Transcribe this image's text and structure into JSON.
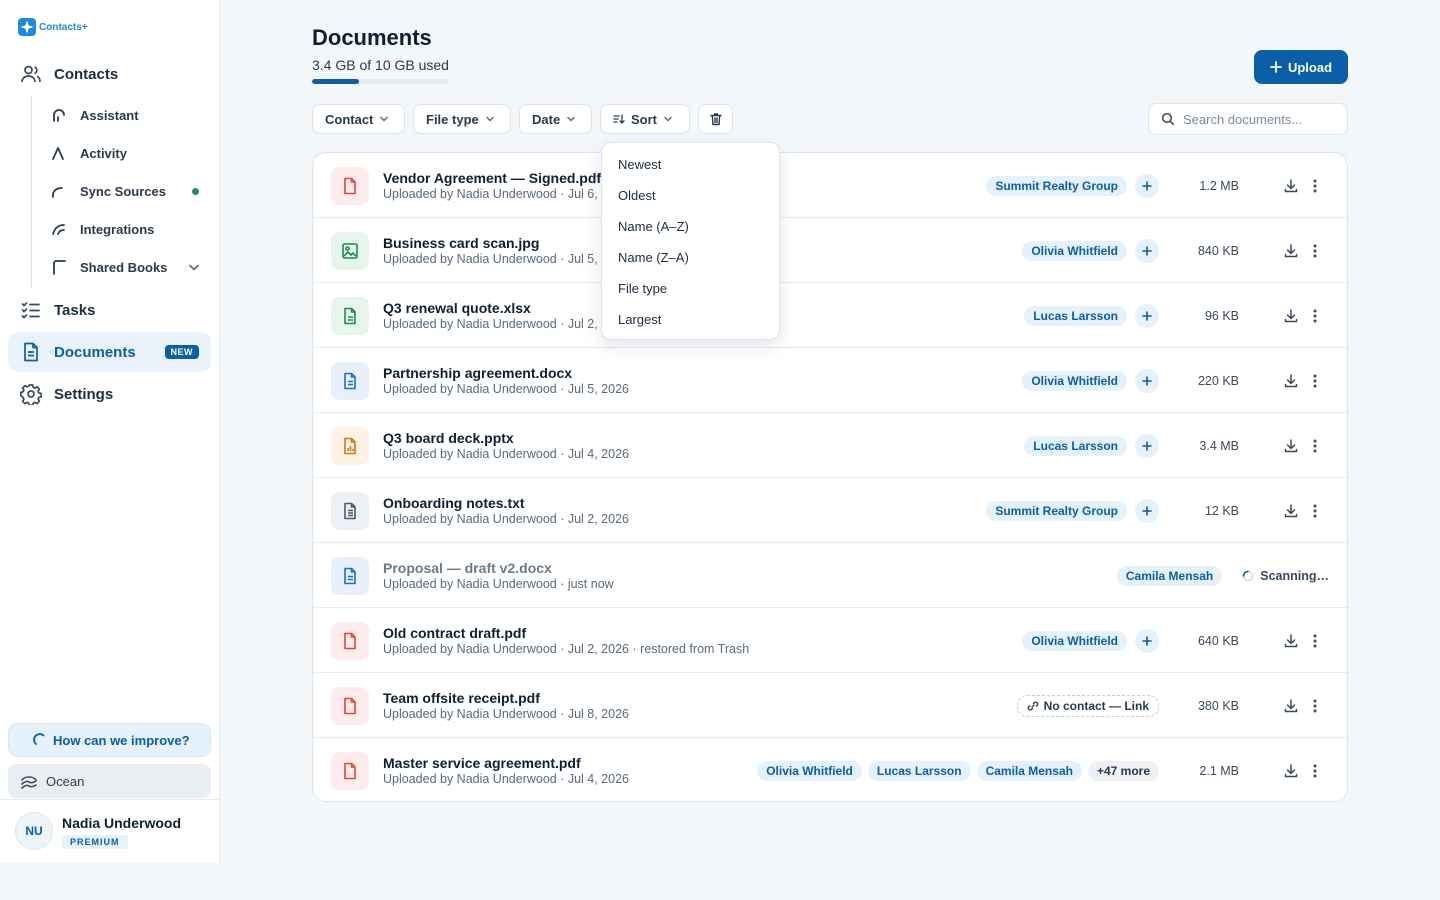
{
  "app": {
    "logo_text": "Contacts+"
  },
  "sidebar": {
    "main": [
      {
        "label": "Contacts",
        "icon": "users-icon"
      },
      {
        "label": "Tasks",
        "icon": "tasks-icon"
      },
      {
        "label": "Documents",
        "icon": "document-icon",
        "badge": "NEW",
        "active": true
      },
      {
        "label": "Settings",
        "icon": "gear-icon"
      }
    ],
    "sub": [
      {
        "label": "Assistant",
        "icon": "assistant-icon"
      },
      {
        "label": "Activity",
        "icon": "activity-icon"
      },
      {
        "label": "Sync Sources",
        "icon": "sync-icon",
        "status": "active"
      },
      {
        "label": "Integrations",
        "icon": "integrations-icon"
      },
      {
        "label": "Shared Books",
        "icon": "shared-books-icon"
      }
    ],
    "improve_label": "How can we improve?",
    "theme_label": "Ocean",
    "user": {
      "initials": "NU",
      "name": "Nadia Underwood",
      "plan": "PREMIUM"
    }
  },
  "header": {
    "title": "Documents",
    "storage_text": "3.4 GB of 10 GB used",
    "storage_used_fraction": 0.34,
    "upload_label": "Upload"
  },
  "filters": {
    "contact": "Contact",
    "file_type": "File type",
    "date": "Date",
    "sort": "Sort",
    "search_placeholder": "Search documents..."
  },
  "sort_menu": [
    "Newest",
    "Oldest",
    "Name (A–Z)",
    "Name (Z–A)",
    "File type",
    "Largest"
  ],
  "documents": [
    {
      "name": "Vendor Agreement — Signed.pdf",
      "meta": "Uploaded by Nadia Underwood · Jul 6, 2026",
      "type": "pdf",
      "tags": [
        "Summit Realty Group"
      ],
      "size": "1.2 MB"
    },
    {
      "name": "Business card scan.jpg",
      "meta": "Uploaded by Nadia Underwood · Jul 5, 2026",
      "type": "img",
      "tags": [
        "Olivia Whitfield"
      ],
      "size": "840 KB"
    },
    {
      "name": "Q3 renewal quote.xlsx",
      "meta": "Uploaded by Nadia Underwood · Jul 2, 2026",
      "type": "xls",
      "tags": [
        "Lucas Larsson"
      ],
      "size": "96 KB"
    },
    {
      "name": "Partnership agreement.docx",
      "meta": "Uploaded by Nadia Underwood · Jul 5, 2026",
      "type": "doc",
      "tags": [
        "Olivia Whitfield"
      ],
      "size": "220 KB"
    },
    {
      "name": "Q3 board deck.pptx",
      "meta": "Uploaded by Nadia Underwood · Jul 4, 2026",
      "type": "ppt",
      "tags": [
        "Lucas Larsson"
      ],
      "size": "3.4 MB"
    },
    {
      "name": "Onboarding notes.txt",
      "meta": "Uploaded by Nadia Underwood · Jul 2, 2026",
      "type": "txt",
      "tags": [
        "Summit Realty Group"
      ],
      "size": "12 KB"
    },
    {
      "name": "Proposal — draft v2.docx",
      "meta": "Uploaded by Nadia Underwood · just now",
      "type": "doc",
      "tags": [
        "Camila Mensah"
      ],
      "status": "Scanning…",
      "muted": true
    },
    {
      "name": "Old contract draft.pdf",
      "meta": "Uploaded by Nadia Underwood · Jul 2, 2026 · restored from Trash",
      "type": "pdf",
      "tags": [
        "Olivia Whitfield"
      ],
      "size": "640 KB"
    },
    {
      "name": "Team offsite receipt.pdf",
      "meta": "Uploaded by Nadia Underwood · Jul 8, 2026",
      "type": "pdf",
      "link": "No contact — Link",
      "size": "380 KB"
    },
    {
      "name": "Master service agreement.pdf",
      "meta": "Uploaded by Nadia Underwood · Jul 4, 2026",
      "type": "pdf",
      "tags": [
        "Olivia Whitfield",
        "Lucas Larsson",
        "Camila Mensah"
      ],
      "more": "+47 more",
      "size": "2.1 MB"
    }
  ],
  "colors": {
    "accent": "#0b5ea8",
    "success": "#11956b",
    "pdf": "#d9473f"
  }
}
